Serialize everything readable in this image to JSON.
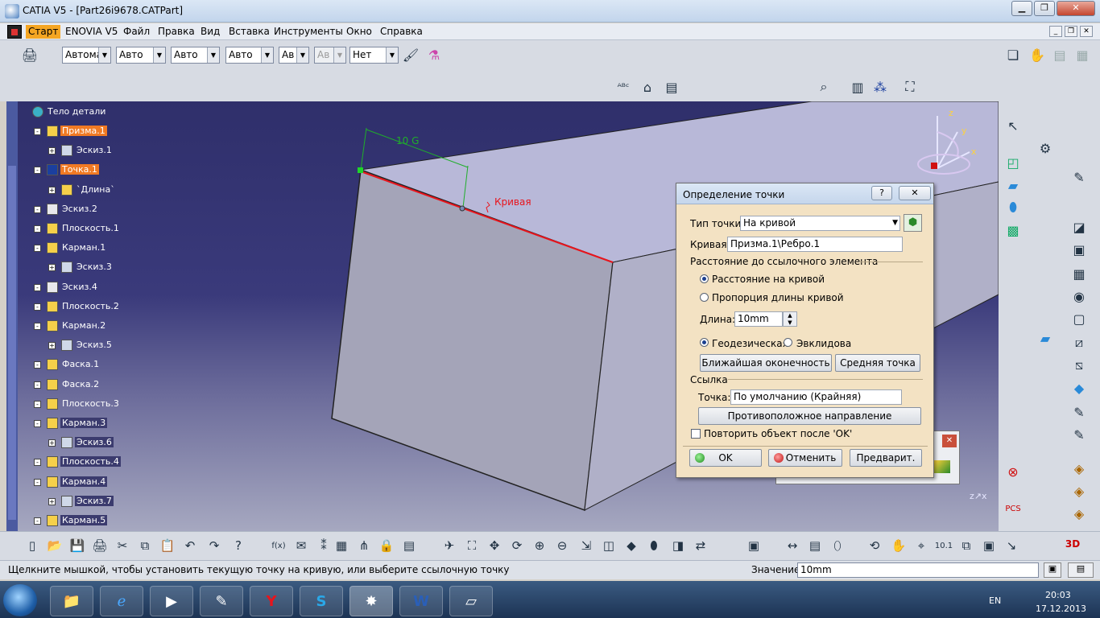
{
  "window": {
    "title": "CATIA V5 - [Part26i9678.CATPart]",
    "controls": [
      "▁",
      "❐",
      "✕"
    ]
  },
  "menu": {
    "items": [
      "Старт",
      "ENOVIA V5",
      "Файл",
      "Правка",
      "Вид",
      "Вставка",
      "Инструменты",
      "Окно",
      "Справка"
    ]
  },
  "toolbar": {
    "combos": [
      "Автома",
      "Авто",
      "Авто",
      "Авто",
      "Ав",
      "Ав",
      "Нет"
    ]
  },
  "tree": {
    "root": "Тело детали",
    "items": [
      {
        "label": "Призма.1",
        "state": "hl"
      },
      {
        "label": "Эскиз.1",
        "state": ""
      },
      {
        "label": "Точка.1",
        "state": "hl"
      },
      {
        "label": "`Длина`",
        "state": ""
      },
      {
        "label": "Эскиз.2",
        "state": ""
      },
      {
        "label": "Плоскость.1",
        "state": ""
      },
      {
        "label": "Карман.1",
        "state": ""
      },
      {
        "label": "Эскиз.3",
        "state": ""
      },
      {
        "label": "Эскиз.4",
        "state": ""
      },
      {
        "label": "Плоскость.2",
        "state": ""
      },
      {
        "label": "Карман.2",
        "state": ""
      },
      {
        "label": "Эскиз.5",
        "state": ""
      },
      {
        "label": "Фаска.1",
        "state": ""
      },
      {
        "label": "Фаска.2",
        "state": ""
      },
      {
        "label": "Плоскость.3",
        "state": ""
      },
      {
        "label": "Карман.3",
        "state": "sel"
      },
      {
        "label": "Эскиз.6",
        "state": "sel"
      },
      {
        "label": "Плоскость.4",
        "state": "sel"
      },
      {
        "label": "Карман.4",
        "state": "sel"
      },
      {
        "label": "Эскиз.7",
        "state": "sel"
      },
      {
        "label": "Карман.5",
        "state": "sel"
      }
    ]
  },
  "viewport": {
    "dimension_label": "10 G",
    "curve_label": "Кривая",
    "compass": {
      "x": "x",
      "y": "y",
      "z": "z"
    }
  },
  "dialog": {
    "title": "Определение точки",
    "help_btn": "?",
    "close_btn": "✕",
    "point_type_label": "Тип точки:",
    "point_type_value": "На кривой",
    "curve_label": "Кривая:",
    "curve_value": "Призма.1\\Ребро.1",
    "distance_section": "Расстояние до ссылочного элемента",
    "radio_dist_on_curve": "Расстояние на кривой",
    "radio_ratio": "Пропорция длины кривой",
    "length_label": "Длина:",
    "length_value": "10mm",
    "radio_geodesic": "Геодезическая",
    "radio_euclid": "Эвклидова",
    "btn_nearest": "Ближайшая оконечность",
    "btn_middle": "Средняя точка",
    "reference_section": "Ссылка",
    "point_label": "Точка:",
    "point_value": "По умолчанию (Крайняя)",
    "btn_reverse": "Противоположное направление",
    "repeat_label": "Повторить объект после 'OK'",
    "btn_ok": "OK",
    "btn_cancel": "Отменить",
    "btn_preview": "Предварит."
  },
  "status": {
    "message": "Щелкните мышкой, чтобы установить текущую точку на кривую, или выберите ссылочную точку",
    "value_label": "Значение",
    "value_input": "10mm"
  },
  "taskbar": {
    "lang": "EN",
    "time": "20:03",
    "date": "17.12.2013"
  },
  "colors": {
    "highlight": "#f07a24",
    "curve": "#e8141c",
    "dimension": "#1fae2a",
    "dialog_bg": "#f3e2c3"
  }
}
